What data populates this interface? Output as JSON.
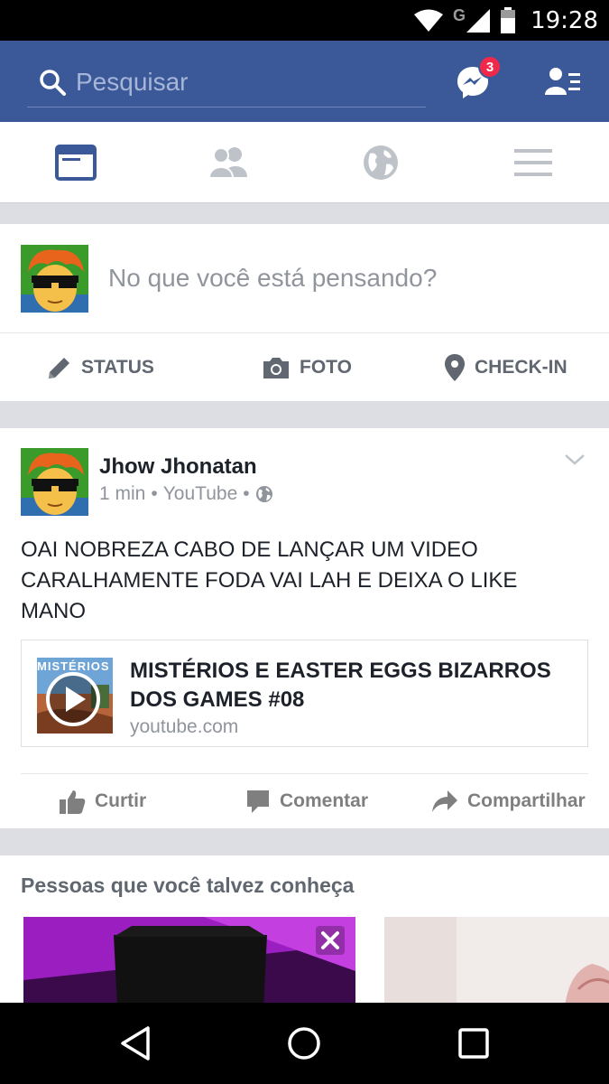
{
  "status_bar": {
    "time": "19:28",
    "network": "G"
  },
  "search": {
    "placeholder": "Pesquisar"
  },
  "header": {
    "messenger_badge": "3"
  },
  "composer": {
    "prompt": "No que você está pensando?",
    "actions": [
      {
        "label": "STATUS",
        "icon": "pencil-icon"
      },
      {
        "label": "FOTO",
        "icon": "camera-icon"
      },
      {
        "label": "CHECK-IN",
        "icon": "location-pin-icon"
      }
    ]
  },
  "post": {
    "author": "Jhow Jhonatan",
    "time": "1 min",
    "source": "YouTube",
    "sep": "•",
    "text": "OAI NOBREZA CABO DE LANÇAR UM VIDEO CARALHAMENTE FODA VAI LAH E DEIXA O LIKE MANO",
    "link": {
      "title": "MISTÉRIOS E EASTER EGGS BIZARROS DOS GAMES #08",
      "domain": "youtube.com",
      "thumb_text": "MISTÉRIOS"
    },
    "actions": [
      {
        "label": "Curtir",
        "icon": "thumbs-up-icon"
      },
      {
        "label": "Comentar",
        "icon": "comment-icon"
      },
      {
        "label": "Compartilhar",
        "icon": "share-icon"
      }
    ]
  },
  "pymk": {
    "heading": "Pessoas que você talvez conheça"
  },
  "colors": {
    "brand": "#3b5998",
    "badge": "#f02849",
    "muted": "#90949c"
  }
}
